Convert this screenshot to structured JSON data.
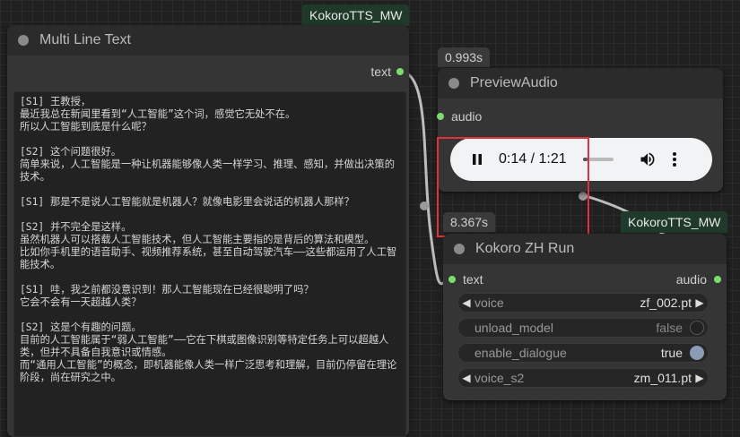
{
  "groups": {
    "top": "KokoroTTS_MW",
    "right": "KokoroTTS_MW"
  },
  "text_node": {
    "title": "Multi Line Text",
    "output": "text",
    "content": "[S1] 王教授，\n最近我总在新闻里看到“人工智能”这个词，感觉它无处不在。\n所以人工智能到底是什么呢？\n\n[S2] 这个问题很好。\n简单来说，人工智能是一种让机器能够像人类一样学习、推理、感知，并做出决策的技术。\n\n[S1] 那是不是说人工智能就是机器人？就像电影里会说话的机器人那样？\n\n[S2] 并不完全是这样。\n虽然机器人可以搭载人工智能技术，但人工智能主要指的是背后的算法和模型。\n比如你手机里的语音助手、视频推荐系统，甚至自动驾驶汽车——这些都运用了人工智能技术。\n\n[S1] 哇，我之前都没意识到！那人工智能现在已经很聪明了吗？\n它会不会有一天超越人类？\n\n[S2] 这是个有趣的问题。\n目前的人工智能属于“弱人工智能”——它在下棋或图像识别等特定任务上可以超越人类，但并不具备自我意识或情感。\n而“通用人工智能”的概念，即机器能像人类一样广泛思考和理解，目前仍停留在理论阶段，尚在研究之中。"
  },
  "preview_node": {
    "badge": "0.993s",
    "title": "PreviewAudio",
    "input": "audio",
    "player": {
      "time": "0:14 / 1:21",
      "progress": 0.17
    }
  },
  "run_node": {
    "badge": "8.367s",
    "title": "Kokoro ZH Run",
    "input": "text",
    "output": "audio",
    "widgets": [
      {
        "label": "voice",
        "value": "zf_002.pt"
      },
      {
        "label": "unload_model",
        "value": "false"
      },
      {
        "label": "enable_dialogue",
        "value": "true"
      },
      {
        "label": "voice_s2",
        "value": "zm_011.pt"
      }
    ]
  },
  "colors": {
    "port": "#7ddc6f",
    "highlight": "#e0323c",
    "group": "#1f3a2a"
  }
}
